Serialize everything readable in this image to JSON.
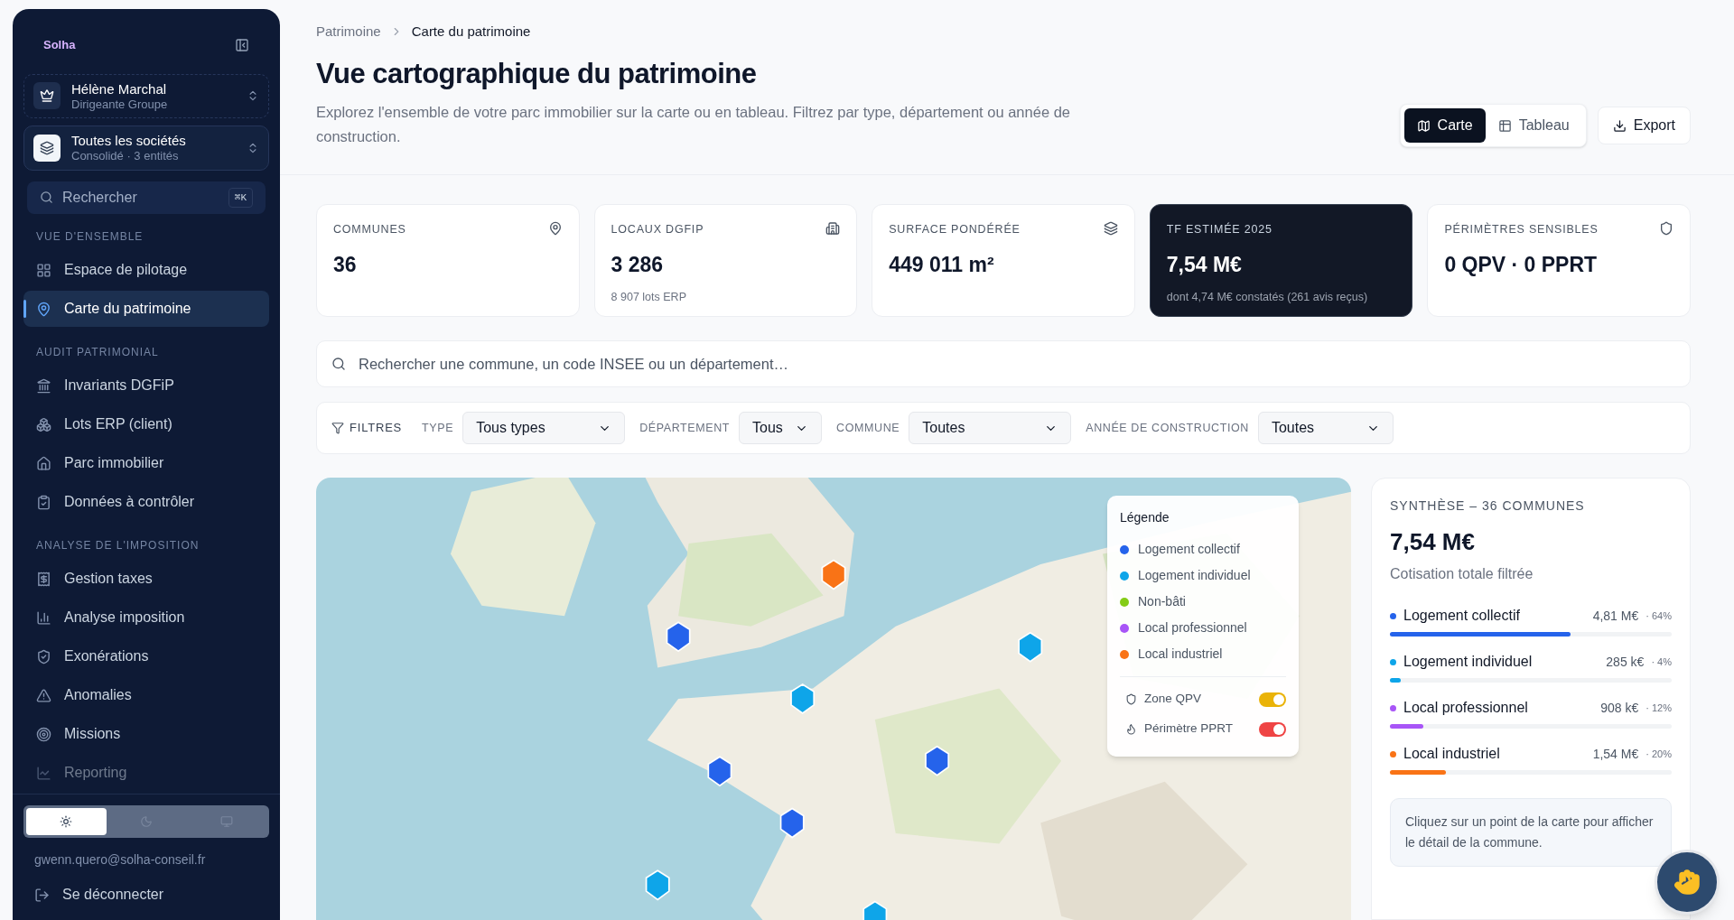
{
  "sidebar": {
    "logo": "Solha",
    "user": {
      "name": "Hélène Marchal",
      "role": "Dirigeante Groupe"
    },
    "org": {
      "name": "Toutes les sociétés",
      "detail": "Consolidé · 3 entités"
    },
    "search": {
      "placeholder": "Rechercher",
      "shortcut": "⌘K"
    },
    "sections": [
      {
        "title": "VUE D'ENSEMBLE",
        "items": [
          {
            "label": "Espace de pilotage",
            "selected": false
          },
          {
            "label": "Carte du patrimoine",
            "selected": true
          }
        ]
      },
      {
        "title": "AUDIT PATRIMONIAL",
        "items": [
          {
            "label": "Invariants DGFiP",
            "selected": false
          },
          {
            "label": "Lots ERP (client)",
            "selected": false
          },
          {
            "label": "Parc immobilier",
            "selected": false
          },
          {
            "label": "Données à contrôler",
            "selected": false
          }
        ]
      },
      {
        "title": "ANALYSE DE L'IMPOSITION",
        "items": [
          {
            "label": "Gestion taxes",
            "selected": false
          },
          {
            "label": "Analyse imposition",
            "selected": false
          },
          {
            "label": "Exonérations",
            "selected": false
          },
          {
            "label": "Anomalies",
            "selected": false
          },
          {
            "label": "Missions",
            "selected": false
          },
          {
            "label": "Reporting",
            "selected": false
          }
        ]
      }
    ],
    "theme": [
      {
        "selected": true
      },
      {
        "selected": false
      },
      {
        "selected": false
      }
    ],
    "email": "gwenn.quero@solha-conseil.fr",
    "logout": "Se déconnecter"
  },
  "breadcrumb": [
    "Patrimoine",
    "Carte du patrimoine"
  ],
  "title": "Vue cartographique du patrimoine",
  "description": "Explorez l'ensemble de votre parc immobilier sur la carte ou en tableau. Filtrez par type, département ou année de construction.",
  "views": [
    {
      "label": "Carte",
      "selected": true
    },
    {
      "label": "Tableau",
      "selected": false
    }
  ],
  "export": "Export",
  "kpis": [
    {
      "label": "COMMUNES",
      "value": "36",
      "highlighted": false
    },
    {
      "label": "LOCAUX DGFIP",
      "value": "3 286",
      "sub": "8 907 lots ERP",
      "highlighted": false
    },
    {
      "label": "SURFACE PONDÉRÉE",
      "value": "449 011 m²",
      "highlighted": false
    },
    {
      "label": "TF ESTIMÉE 2025",
      "value": "7,54 M€",
      "sub": "dont 4,74 M€ constatés (261 avis reçus)",
      "highlighted": true
    },
    {
      "label": "PÉRIMÈTRES SENSIBLES",
      "value": "0 QPV · 0 PPRT",
      "highlighted": false
    }
  ],
  "search": {
    "placeholder": "Rechercher une commune, un code INSEE ou un département…"
  },
  "filters": {
    "label": "FILTRES",
    "fields": [
      {
        "label": "TYPE",
        "value": "Tous types"
      },
      {
        "label": "DÉPARTEMENT",
        "value": "Tous"
      },
      {
        "label": "COMMUNE",
        "value": "Toutes"
      },
      {
        "label": "ANNÉE DE CONSTRUCTION",
        "value": "Toutes"
      }
    ]
  },
  "legend": {
    "title": "Légende",
    "items": [
      {
        "label": "Logement collectif",
        "color": "#2563eb"
      },
      {
        "label": "Logement individuel",
        "color": "#0ea5e9"
      },
      {
        "label": "Non-bâti",
        "color": "#84cc16"
      },
      {
        "label": "Local professionnel",
        "color": "#a855f7"
      },
      {
        "label": "Local industriel",
        "color": "#f97316"
      }
    ],
    "layers": [
      {
        "label": "Zone QPV",
        "on": true,
        "color": "#eab308"
      },
      {
        "label": "Périmètre PPRT",
        "on": true,
        "color": "#ef4444"
      }
    ]
  },
  "summary": {
    "title": "SYNTHÈSE – 36 COMMUNES",
    "value": "7,54 M€",
    "caption": "Cotisation totale filtrée",
    "rows": [
      {
        "label": "Logement collectif",
        "amount": "4,81 M€",
        "share": "· 64%",
        "level": 0.64,
        "color": "#2563eb"
      },
      {
        "label": "Logement individuel",
        "amount": "285 k€",
        "share": "· 4%",
        "level": 0.04,
        "color": "#0ea5e9"
      },
      {
        "label": "Local professionnel",
        "amount": "908 k€",
        "share": "· 12%",
        "level": 0.12,
        "color": "#a855f7"
      },
      {
        "label": "Local industriel",
        "amount": "1,54 M€",
        "share": "· 20%",
        "level": 0.2,
        "color": "#f97316"
      }
    ],
    "hint": "Cliquez sur un point de la carte pour afficher le détail de la commune."
  }
}
